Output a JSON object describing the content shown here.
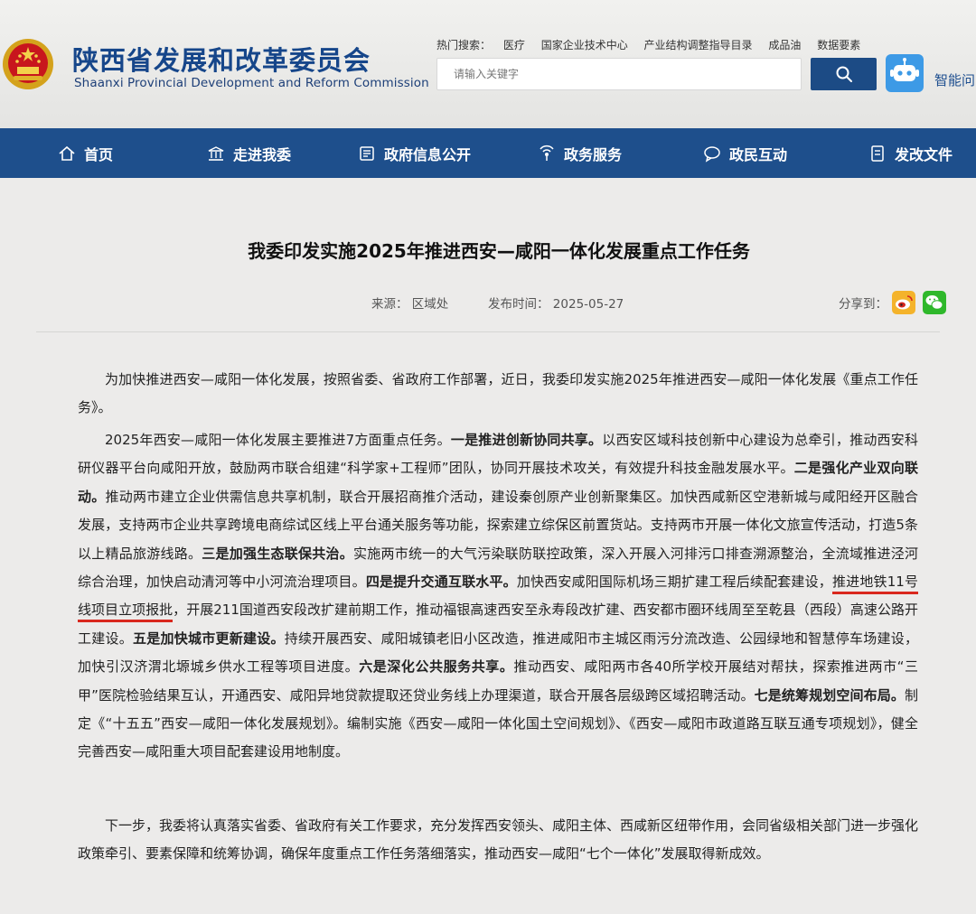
{
  "header": {
    "title": "陕西省发展和改革委员会",
    "subtitle": "Shaanxi Provincial Development and Reform Commission",
    "hot_search_label": "热门搜索：",
    "hot_search_items": [
      "医疗",
      "国家企业技术中心",
      "产业结构调整指导目录",
      "成品油",
      "数据要素"
    ],
    "search_placeholder": "请输入关键字",
    "smart_qa_label": "智能问"
  },
  "nav": {
    "items": [
      {
        "label": "首页",
        "icon": "home-icon"
      },
      {
        "label": "走进我委",
        "icon": "building-icon"
      },
      {
        "label": "政府信息公开",
        "icon": "document-icon"
      },
      {
        "label": "政务服务",
        "icon": "broadcast-icon"
      },
      {
        "label": "政民互动",
        "icon": "chat-icon"
      },
      {
        "label": "发改文件",
        "icon": "file-icon"
      }
    ],
    "active_color": "#1e4f8c"
  },
  "article": {
    "title": "我委印发实施2025年推进西安—咸阳一体化发展重点工作任务",
    "source_label": "来源：",
    "source": "区域处",
    "date_label": "发布时间：",
    "date": "2025-05-27",
    "share_label": "分享到：",
    "share_icons": [
      "weibo-icon",
      "wechat-icon"
    ],
    "highlight_color": "#d9281e",
    "p1": "为加快推进西安—咸阳一体化发展，按照省委、省政府工作部署，近日，我委印发实施2025年推进西安—咸阳一体化发展《重点工作任务》。",
    "p2": {
      "t1": "2025年西安—咸阳一体化发展主要推进7方面重点任务。",
      "b1": "一是推进创新协同共享。",
      "t2": "以西安区域科技创新中心建设为总牵引，推动西安科研仪器平台向咸阳开放，鼓励两市联合组建“科学家+工程师”团队，协同开展技术攻关，有效提升科技金融发展水平。",
      "b2": "二是强化产业双向联动。",
      "t3": "推动两市建立企业供需信息共享机制，联合开展招商推介活动，建设秦创原产业创新聚集区。加快西咸新区空港新城与咸阳经开区融合发展，支持两市企业共享跨境电商综试区线上平台通关服务等功能，探索建立综保区前置货站。支持两市开展一体化文旅宣传活动，打造5条以上精品旅游线路。",
      "b3": "三是加强生态联保共治。",
      "t4": "实施两市统一的大气污染联防联控政策，深入开展入河排污口排查溯源整治，全流域推进泾河综合治理，加快启动清河等中小河流治理项目。",
      "b4": "四是提升交通互联水平。",
      "t5": "加快西安咸阳国际机场三期扩建工程后续配套建设，",
      "h1": "推进地铁11号线项目立项报批",
      "t6": "，开展211国道西安段改扩建前期工作，推动福银高速西安至永寿段改扩建、西安都市圈环线周至至乾县（西段）高速公路开工建设。",
      "b5": "五是加快城市更新建设。",
      "t7": "持续开展西安、咸阳城镇老旧小区改造，推进咸阳市主城区雨污分流改造、公园绿地和智慧停车场建设，加快引汉济渭北塬城乡供水工程等项目进度。",
      "b6": "六是深化公共服务共享。",
      "t8": "推动西安、咸阳两市各40所学校开展结对帮扶，探索推进两市“三甲”医院检验结果互认，开通西安、咸阳异地贷款提取还贷业务线上办理渠道，联合开展各层级跨区域招聘活动。",
      "b7": "七是统筹规划空间布局。",
      "t9": "制定《“十五五”西安—咸阳一体化发展规划》。编制实施《西安—咸阳一体化国土空间规划》、《西安—咸阳市政道路互联互通专项规划》，健全完善西安—咸阳重大项目配套建设用地制度。"
    },
    "p3": "下一步，我委将认真落实省委、省政府有关工作要求，充分发挥西安领头、咸阳主体、西咸新区纽带作用，会同省级相关部门进一步强化政策牵引、要素保障和统筹协调，确保年度重点工作任务落细落实，推动西安—咸阳“七个一体化”发展取得新成效。"
  }
}
